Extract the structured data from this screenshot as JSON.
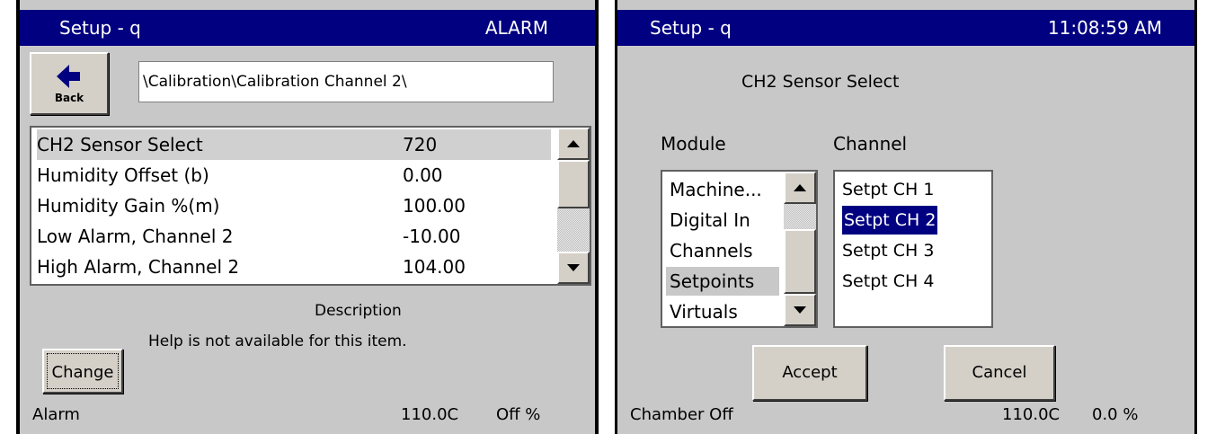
{
  "left": {
    "title": "Setup - q",
    "title_right": "ALARM",
    "back_label": "Back",
    "path": "\\Calibration\\Calibration Channel 2\\",
    "rows": [
      {
        "label": "CH2 Sensor Select",
        "value": "720"
      },
      {
        "label": "Humidity Offset (b)",
        "value": "0.00"
      },
      {
        "label": "Humidity Gain %(m)",
        "value": "100.00"
      },
      {
        "label": "Low Alarm, Channel 2",
        "value": "-10.00"
      },
      {
        "label": "High Alarm, Channel 2",
        "value": "104.00"
      }
    ],
    "selected_row": 0,
    "description_title": "Description",
    "description_text": "Help is not available for this item.",
    "change_label": "Change",
    "status_left": "Alarm",
    "status_temp": "110.0C",
    "status_hum": "Off %"
  },
  "right": {
    "title": "Setup - q",
    "time": "11:08:59 AM",
    "dialog_title": "CH2 Sensor Select",
    "module_label": "Module",
    "channel_label": "Channel",
    "modules": [
      "Machine...",
      "Digital In",
      "Channels",
      "Setpoints",
      "Virtuals"
    ],
    "selected_module": 3,
    "channels": [
      "Setpt CH 1",
      "Setpt CH 2",
      "Setpt CH 3",
      "Setpt CH 4"
    ],
    "selected_channel": 1,
    "accept_label": "Accept",
    "cancel_label": "Cancel",
    "status_left": "Chamber Off",
    "status_temp": "110.0C",
    "status_hum": "0.0 %"
  },
  "colors": {
    "titlebar": "#000080",
    "panel_bg": "#c8c8c8",
    "selection": "#000080"
  },
  "icons": {
    "back": "arrow-left-icon",
    "scroll_up": "triangle-up-icon",
    "scroll_down": "triangle-down-icon"
  }
}
